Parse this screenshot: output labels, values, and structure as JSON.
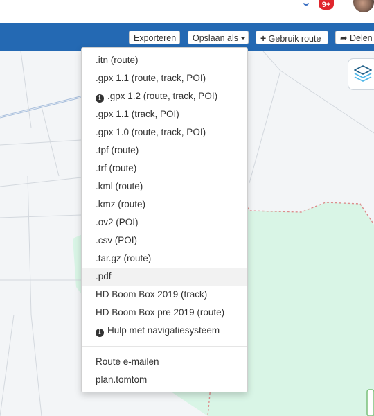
{
  "header": {
    "notification_count": "9+"
  },
  "toolbar": {
    "export_label": "Exporteren",
    "save_as_label": "Opslaan als",
    "use_route_label": "Gebruik route",
    "share_label": "Delen"
  },
  "menu": {
    "items": [
      {
        "label": ".itn (route)"
      },
      {
        "label": ".gpx 1.1 (route, track, POI)"
      },
      {
        "label": ".gpx 1.2 (route, track, POI)"
      },
      {
        "label": ".gpx 1.1 (track, POI)"
      },
      {
        "label": ".gpx 1.0 (route, track, POI)"
      },
      {
        "label": ".tpf (route)"
      },
      {
        "label": ".trf (route)"
      },
      {
        "label": ".kml (route)"
      },
      {
        "label": ".kmz (route)"
      },
      {
        "label": ".ov2 (POI)"
      },
      {
        "label": ".csv (POI)"
      },
      {
        "label": ".tar.gz (route)"
      },
      {
        "label": ".pdf"
      },
      {
        "label": "HD Boom Box 2019 (track)"
      },
      {
        "label": "HD Boom Box pre 2019 (route)"
      },
      {
        "label": "Hulp met navigatiesysteem"
      }
    ],
    "email_route_label": "Route e-mailen",
    "tomtom_label": "plan.tomtom"
  },
  "colors": {
    "toolbar_blue": "#2469b3",
    "map_park_green": "#d9f5e6",
    "menu_hover": "#f2f2f2"
  }
}
